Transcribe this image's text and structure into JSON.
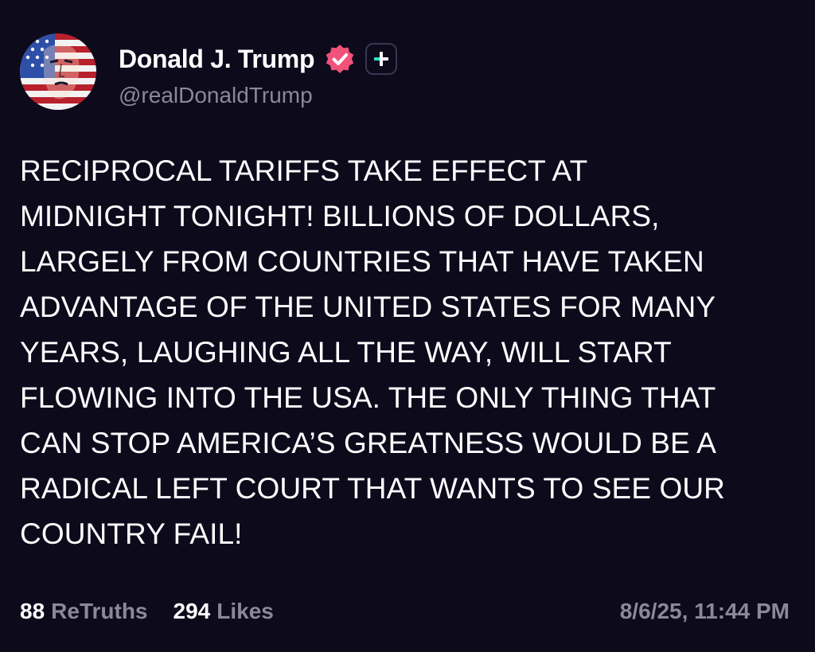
{
  "author": {
    "display_name": "Donald J. Trump",
    "handle": "@realDonaldTrump",
    "verified_icon": "verified-badge-icon",
    "plus_icon": "plus-icon"
  },
  "post": {
    "text": "RECIPROCAL TARIFFS TAKE EFFECT AT\nMIDNIGHT TONIGHT! BILLIONS OF DOLLARS,\nLARGELY FROM COUNTRIES THAT HAVE TAKEN\nADVANTAGE OF THE UNITED STATES FOR MANY\nYEARS, LAUGHING ALL THE WAY, WILL START\nFLOWING INTO THE USA. THE ONLY THING THAT\nCAN STOP AMERICA’S GREATNESS WOULD BE A\nRADICAL LEFT COURT THAT WANTS TO SEE OUR\nCOUNTRY FAIL!"
  },
  "stats": {
    "retruths_count": "88",
    "retruths_label": "ReTruths",
    "likes_count": "294",
    "likes_label": "Likes"
  },
  "timestamp": "8/6/25, 11:44 PM",
  "colors": {
    "background": "#0d0a1c",
    "muted_text": "#8c8899",
    "verified_badge": "#f0527a",
    "plus_accent": "#2ee0c8"
  }
}
